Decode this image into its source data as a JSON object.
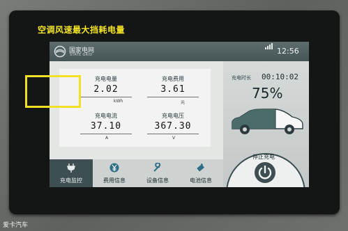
{
  "caption": "空调风速最大挡耗电量",
  "watermark": "爱卡汽车",
  "header": {
    "logo_cn": "国家电网",
    "logo_en": "STATE GRID",
    "time": "12:56"
  },
  "metrics": [
    {
      "label": "充电电量",
      "value": "2.02",
      "unit": "kWh"
    },
    {
      "label": "充电费用",
      "value": "3.61",
      "unit": "元"
    },
    {
      "label": "充电电流",
      "value": "37.10",
      "unit": "A"
    },
    {
      "label": "充电电压",
      "value": "367.30",
      "unit": "V"
    }
  ],
  "tabs": [
    {
      "label": "充电监控",
      "icon": "plug-icon",
      "active": true
    },
    {
      "label": "费用信息",
      "icon": "yen-icon",
      "active": false
    },
    {
      "label": "设备信息",
      "icon": "wrench-icon",
      "active": false
    },
    {
      "label": "电池信息",
      "icon": "battery-icon",
      "active": false
    }
  ],
  "status": {
    "duration_label": "充电时长",
    "duration_value": "00:10:02",
    "soc_percent": "75%",
    "stop_label": "停止充电"
  },
  "colors": {
    "caption": "#f5e61f",
    "highlight": "#f1df28",
    "header": "#465556",
    "active_tab": "#3e4f51"
  }
}
